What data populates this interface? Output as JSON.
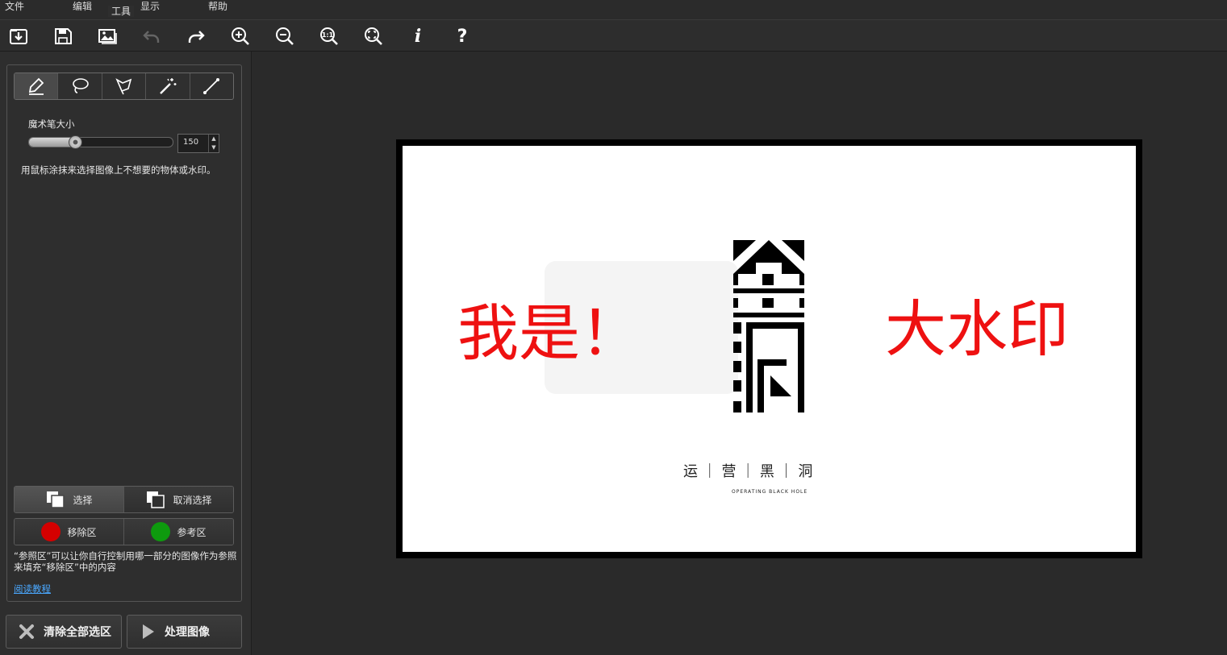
{
  "menu": {
    "file": "文件",
    "edit": "编辑",
    "view": "显示",
    "help": "帮助"
  },
  "toolbar": {
    "icons": [
      "open-icon",
      "save-icon",
      "image-icon",
      "undo-icon",
      "redo-icon",
      "zoom-in-icon",
      "zoom-out-icon",
      "zoom-1-1-icon",
      "fit-screen-icon",
      "info-icon",
      "help-icon"
    ],
    "info_label": "i",
    "help_label": "?",
    "zoom_actual_label": "1:1"
  },
  "tools": {
    "title": "工具",
    "items": [
      "marker-icon",
      "lasso-icon",
      "polygon-lasso-icon",
      "magic-wand-icon",
      "line-icon"
    ],
    "brush_size_label": "魔术笔大小",
    "brush_size_value": "150",
    "brush_size_fraction": 0.32,
    "hint": "用鼠标涂抹来选择图像上不想要的物体或水印。"
  },
  "selection": {
    "select_label": "选择",
    "deselect_label": "取消选择"
  },
  "regions": {
    "remove_label": "移除区",
    "reference_label": "参考区",
    "remove_color": "#d40000",
    "reference_color": "#0e9a0e",
    "note": "“参照区”可以让你自行控制用哪一部分的图像作为参照来填充“移除区”中的内容",
    "tutorial_link": "阅读教程"
  },
  "actions": {
    "clear_label": "清除全部选区",
    "process_label": "处理图像"
  },
  "image": {
    "watermark_left": "我是！",
    "watermark_right": "大水印",
    "logo_text": "运 ｜ 营 ｜ 黑 ｜ 洞",
    "logo_sub": "OPERATING BLACK HOLE",
    "watermark_color": "#ee1111"
  }
}
